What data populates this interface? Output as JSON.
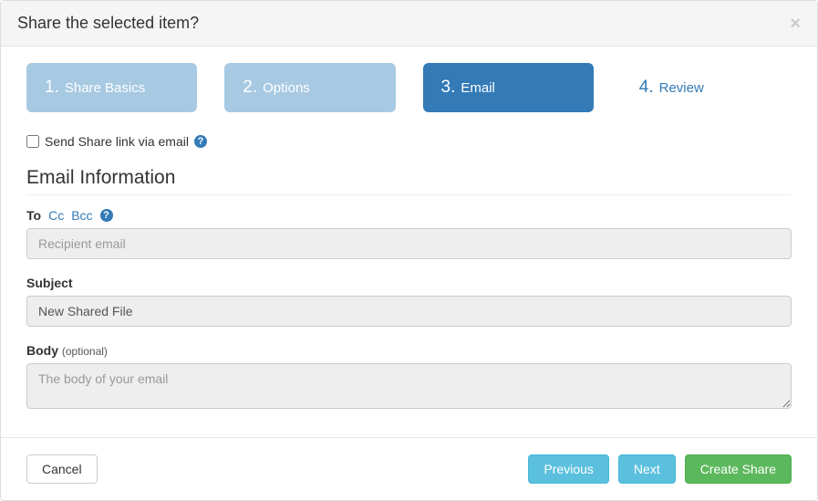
{
  "modal": {
    "title": "Share the selected item?",
    "close_glyph": "×"
  },
  "steps": [
    {
      "num": "1.",
      "label": "Share Basics",
      "state": "done"
    },
    {
      "num": "2.",
      "label": "Options",
      "state": "done"
    },
    {
      "num": "3.",
      "label": "Email",
      "state": "active"
    },
    {
      "num": "4.",
      "label": "Review",
      "state": "pending"
    }
  ],
  "email_toggle": {
    "label": "Send Share link via email",
    "checked": false,
    "help_glyph": "?"
  },
  "section_title": "Email Information",
  "to_row": {
    "to": "To",
    "cc": "Cc",
    "bcc": "Bcc",
    "help_glyph": "?"
  },
  "recipient": {
    "placeholder": "Recipient email",
    "value": ""
  },
  "subject": {
    "label": "Subject",
    "value": "New Shared File"
  },
  "body": {
    "label": "Body",
    "optional": "(optional)",
    "placeholder": "The body of your email",
    "value": ""
  },
  "footer": {
    "cancel": "Cancel",
    "previous": "Previous",
    "next": "Next",
    "create": "Create Share"
  }
}
